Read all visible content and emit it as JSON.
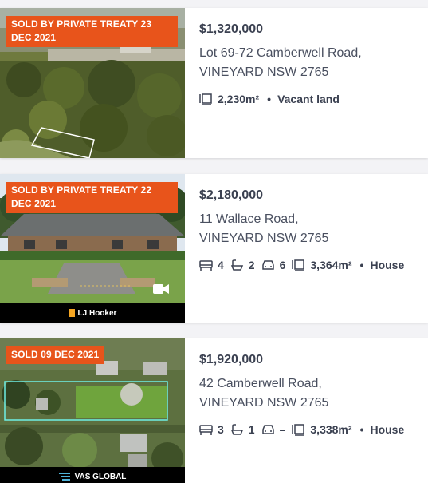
{
  "listings": [
    {
      "sold_label": "SOLD BY PRIVATE TREATY 23 DEC 2021",
      "price": "$1,320,000",
      "address_line1": "Lot 69-72 Camberwell Road,",
      "address_line2": "VINEYARD NSW 2765",
      "land_size": "2,230m²",
      "property_type": "Vacant land"
    },
    {
      "sold_label": "SOLD BY PRIVATE TREATY 22 DEC 2021",
      "price": "$2,180,000",
      "address_line1": "11 Wallace Road,",
      "address_line2": "VINEYARD NSW 2765",
      "bedrooms": "4",
      "bathrooms": "2",
      "parking": "6",
      "land_size": "3,364m²",
      "property_type": "House",
      "agency": "LJ Hooker"
    },
    {
      "sold_label": "SOLD 09 DEC 2021",
      "price": "$1,920,000",
      "address_line1": "42 Camberwell Road,",
      "address_line2": "VINEYARD NSW 2765",
      "bedrooms": "3",
      "bathrooms": "1",
      "parking": "–",
      "land_size": "3,338m²",
      "property_type": "House",
      "agency": "VAS GLOBAL"
    }
  ],
  "icons": {
    "land": "land-size-icon",
    "bed": "bed-icon",
    "bath": "bath-icon",
    "car": "car-icon",
    "video": "video-icon"
  },
  "colors": {
    "sold_badge": "#e8541b",
    "text": "#3b4151",
    "background": "#f3f3f6"
  }
}
